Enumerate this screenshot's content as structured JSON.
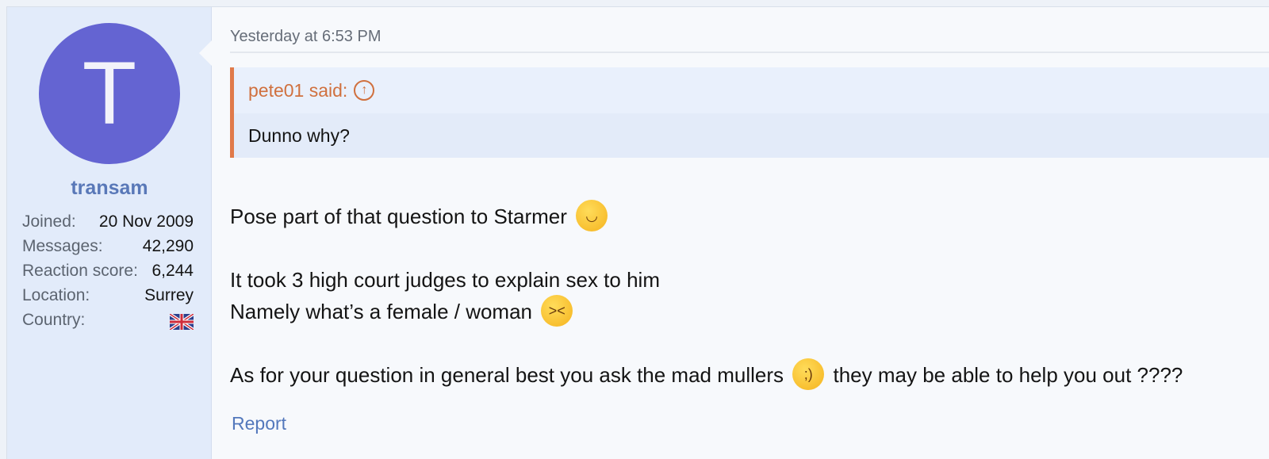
{
  "user": {
    "avatar_letter": "T",
    "avatar_color": "#6464d2",
    "username": "transam",
    "stats": [
      {
        "label": "Joined:",
        "value": "20 Nov 2009"
      },
      {
        "label": "Messages:",
        "value": "42,290"
      },
      {
        "label": "Reaction score:",
        "value": "6,244"
      },
      {
        "label": "Location:",
        "value": "Surrey"
      },
      {
        "label": "Country:",
        "value": "",
        "icon": "uk-flag-icon"
      }
    ]
  },
  "post": {
    "timestamp": "Yesterday at 6:53 PM",
    "quote": {
      "author_line": "pete01 said:",
      "body": "Dunno why?",
      "accent": "#e07a4a"
    },
    "lines": [
      {
        "text": "Pose part of that question to Starmer",
        "emoji": "smiling-face-emoji"
      },
      {
        "text": "It took 3 high court judges to explain sex to him"
      },
      {
        "text": "Namely what’s a female / woman",
        "emoji": "laughing-face-emoji"
      },
      {
        "text_before": "As for your question in general best you ask the mad mullers",
        "emoji": "winking-face-emoji",
        "text_after": "they may be able to help you out ????"
      }
    ],
    "report_label": "Report"
  }
}
